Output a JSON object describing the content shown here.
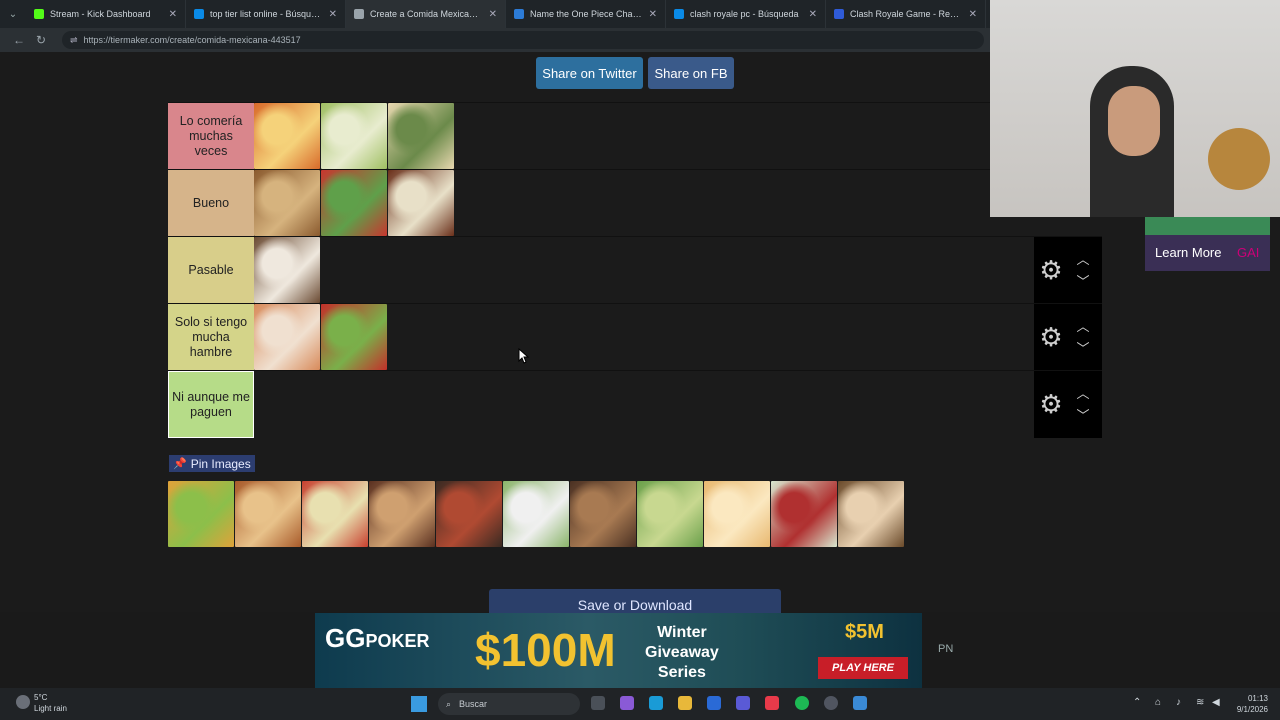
{
  "browser": {
    "tabs": [
      {
        "label": "Stream - Kick Dashboard",
        "fav": "#53fc18",
        "active": false
      },
      {
        "label": "top tier list online - Búsqueda",
        "fav": "#0a8ae6",
        "active": false
      },
      {
        "label": "Create a Comida Mexicana Tier Li",
        "fav": "#9aa4ab",
        "active": true
      },
      {
        "label": "Name the One Piece Characters -",
        "fav": "#2c7bd6",
        "active": false
      },
      {
        "label": "clash royale pc - Búsqueda",
        "fav": "#0a8ae6",
        "active": false
      },
      {
        "label": "Clash Royale Game - Reviewed",
        "fav": "#2f5bd8",
        "active": false
      }
    ],
    "url": "https://tiermaker.com/create/comida-mexicana-443517"
  },
  "share": {
    "twitter": "Share on Twitter",
    "fb": "Share on FB"
  },
  "tiers": [
    {
      "label": "Lo comería muchas veces",
      "color": "#d9868c",
      "items": [
        [
          "#d86a2a",
          "#f5d27a"
        ],
        [
          "#9fbf62",
          "#e8eccf"
        ],
        [
          "#e8d8b0",
          "#6b8a4a"
        ]
      ],
      "controls": false
    },
    {
      "label": "Bueno",
      "color": "#d6b48a",
      "items": [
        [
          "#8a5a2e",
          "#d6b37e"
        ],
        [
          "#c8362f",
          "#5fa04a"
        ],
        [
          "#6a2f1a",
          "#e8e0c8"
        ]
      ],
      "controls": false
    },
    {
      "label": "Pasable",
      "color": "#d8ce8a",
      "items": [
        [
          "#6a4a32",
          "#efe8de"
        ]
      ],
      "controls": true
    },
    {
      "label": "Solo si tengo mucha hambre",
      "color": "#d4d489",
      "items": [
        [
          "#d88a5a",
          "#f0e0d0"
        ],
        [
          "#c42f2a",
          "#7ab04a"
        ]
      ],
      "controls": true
    },
    {
      "label": "Ni aunque me paguen",
      "color": "#b6dc88",
      "items": [],
      "controls": true,
      "selected": true
    }
  ],
  "pin_label": "Pin Images",
  "pool": [
    [
      "#e0a23a",
      "#8cbf4a"
    ],
    [
      "#a85a2a",
      "#e8c28a"
    ],
    [
      "#c8402f",
      "#e8e0b0"
    ],
    [
      "#5a3020",
      "#cfa070"
    ],
    [
      "#3a2a22",
      "#b04a32"
    ],
    [
      "#8ab46a",
      "#f0f0f0"
    ],
    [
      "#4a3022",
      "#a87a52"
    ],
    [
      "#6aa04a",
      "#c8d890"
    ],
    [
      "#e8b870",
      "#fbe8c0"
    ],
    [
      "#d8e8d0",
      "#b03030"
    ],
    [
      "#6a4a2a",
      "#e8d0b0"
    ]
  ],
  "save_label": "Save or Download",
  "side_ad": {
    "learn_more": "Learn More",
    "brand": "GAI"
  },
  "bottom_ad": {
    "brand": "GG",
    "brand2": "POKER",
    "amount": "$100M",
    "line1": "Winter",
    "line2": "Giveaway",
    "line3": "Series",
    "addon": "$5M",
    "cta": "PLAY HERE"
  },
  "pn": "PN",
  "taskbar": {
    "temp": "5°C",
    "weather": "Light rain",
    "search": "Buscar",
    "time": "01:13",
    "date": "9/1/2026"
  }
}
